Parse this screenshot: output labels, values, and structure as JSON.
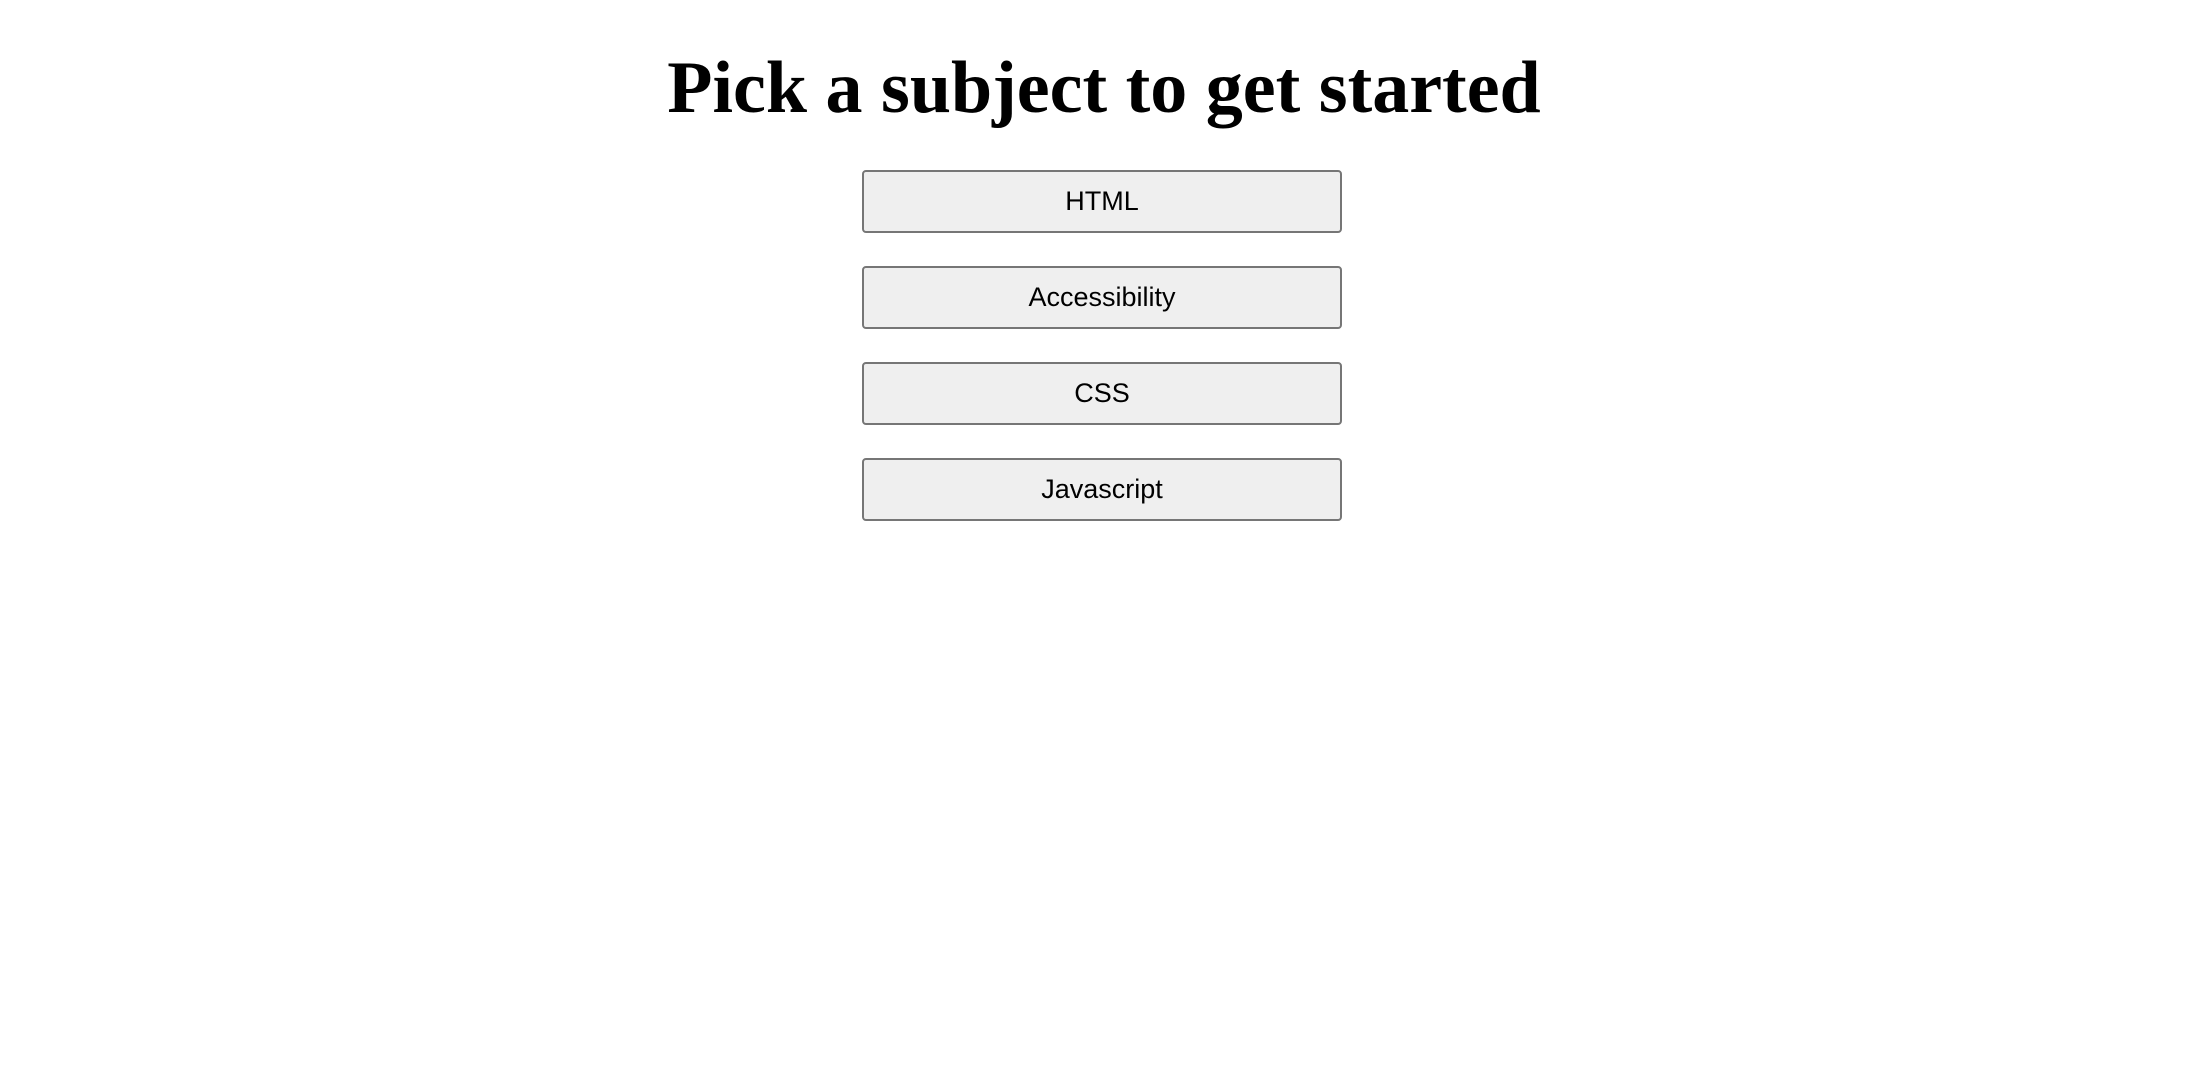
{
  "header": {
    "title": "Pick a subject to get started"
  },
  "subjects": [
    {
      "label": "HTML"
    },
    {
      "label": "Accessibility"
    },
    {
      "label": "CSS"
    },
    {
      "label": "Javascript"
    }
  ],
  "colors": {
    "button_background": "#efefef",
    "button_border": "#767676",
    "text": "#000000",
    "page_background": "#ffffff"
  }
}
